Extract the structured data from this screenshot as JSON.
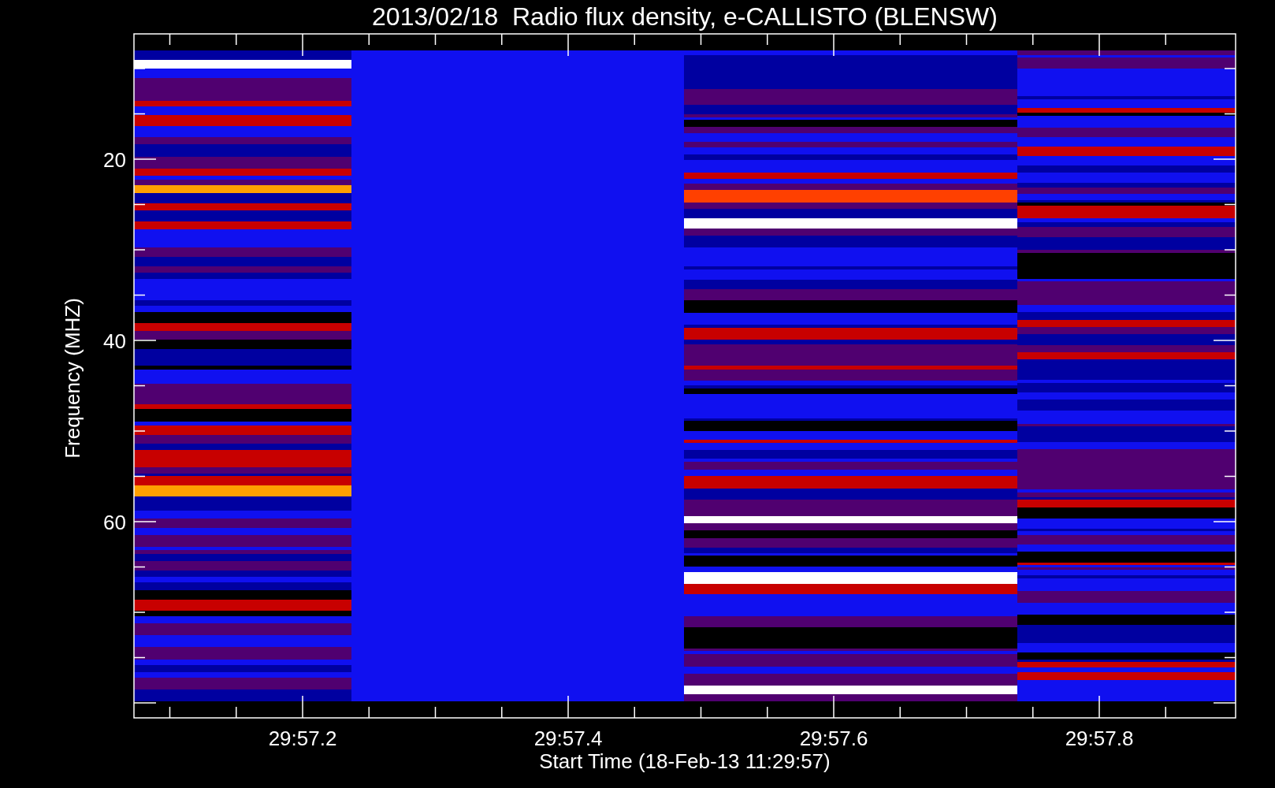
{
  "title": "2013/02/18  Radio flux density, e-CALLISTO (BLENSW)",
  "y_axis": {
    "label": "Frequency (MHZ)",
    "ticks": [
      "20",
      "40",
      "60"
    ]
  },
  "x_axis": {
    "label": "Start Time (18-Feb-13 11:29:57)",
    "ticks": [
      "29:57.2",
      "29:57.4",
      "29:57.6",
      "29:57.8"
    ]
  }
}
